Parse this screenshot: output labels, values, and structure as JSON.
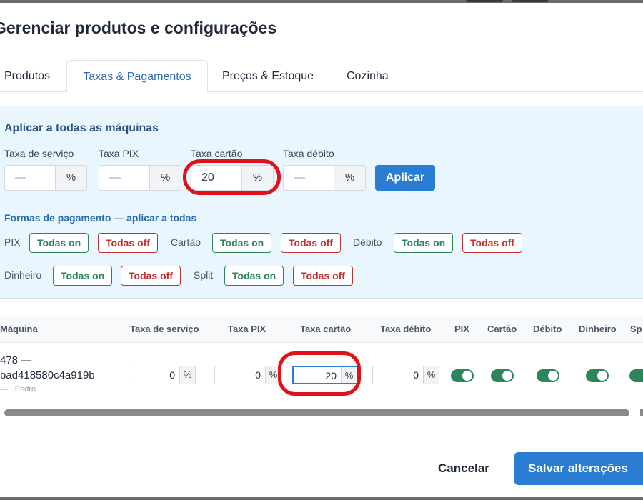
{
  "dialog": {
    "title": "Gerenciar produtos e configurações"
  },
  "tabs": [
    {
      "label": "Produtos",
      "active": false
    },
    {
      "label": "Taxas & Pagamentos",
      "active": true
    },
    {
      "label": "Preços & Estoque",
      "active": false
    },
    {
      "label": "Cozinha",
      "active": false
    }
  ],
  "bulk": {
    "title": "Aplicar a todas as máquinas",
    "fields": [
      {
        "label": "Taxa de serviço",
        "value": "",
        "placeholder": "—",
        "unit": "%"
      },
      {
        "label": "Taxa PIX",
        "value": "",
        "placeholder": "—",
        "unit": "%"
      },
      {
        "label": "Taxa cartão",
        "value": "20",
        "placeholder": "—",
        "unit": "%"
      },
      {
        "label": "Taxa débito",
        "value": "",
        "placeholder": "—",
        "unit": "%"
      }
    ],
    "apply_label": "Aplicar",
    "payments_title": "Formas de pagamento — aplicar a todas",
    "payments": [
      {
        "label": "PIX",
        "on": "Todas on",
        "off": "Todas off"
      },
      {
        "label": "Cartão",
        "on": "Todas on",
        "off": "Todas off"
      },
      {
        "label": "Débito",
        "on": "Todas on",
        "off": "Todas off"
      },
      {
        "label": "Dinheiro",
        "on": "Todas on",
        "off": "Todas off"
      },
      {
        "label": "Split",
        "on": "Todas on",
        "off": "Todas off"
      }
    ]
  },
  "table": {
    "headers": [
      "Máquina",
      "Taxa de serviço",
      "Taxa PIX",
      "Taxa cartão",
      "Taxa débito",
      "PIX",
      "Cartão",
      "Débito",
      "Dinheiro",
      "Sp"
    ],
    "rows": [
      {
        "machine_line1": "478 —",
        "machine_line2": "bad418580c4a919b",
        "machine_sub": "— · Pedro",
        "rates": [
          {
            "value": "0",
            "unit": "%"
          },
          {
            "value": "0",
            "unit": "%"
          },
          {
            "value": "20",
            "unit": "%"
          },
          {
            "value": "0",
            "unit": "%"
          }
        ],
        "toggles": [
          true,
          true,
          true,
          true,
          true
        ]
      }
    ]
  },
  "footer": {
    "cancel_label": "Cancelar",
    "save_label": "Salvar alterações"
  },
  "colors": {
    "accent": "#2b7dd3",
    "on": "#2f855a",
    "off": "#c53030",
    "annotation": "#e0111b"
  }
}
